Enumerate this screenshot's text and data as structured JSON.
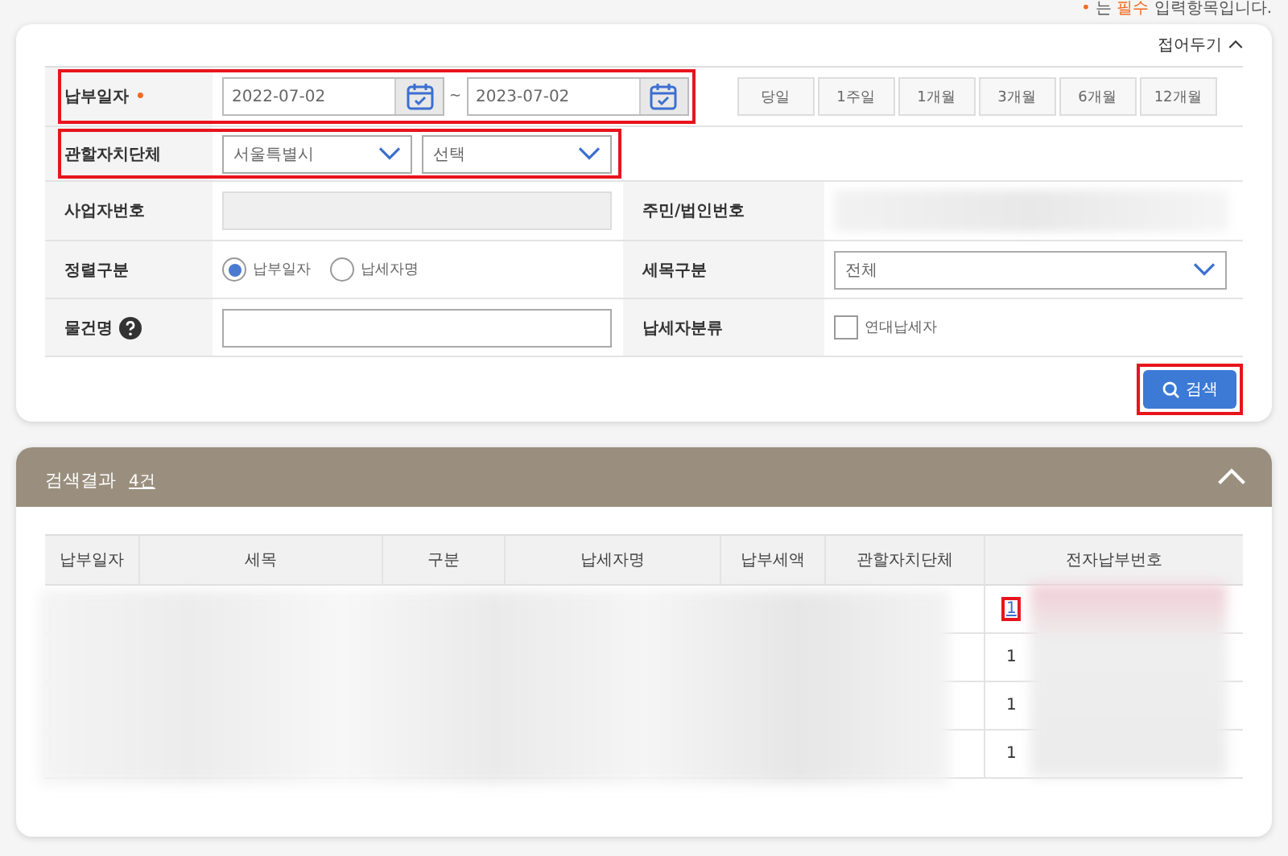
{
  "required_note": {
    "mark": "•",
    "before": "는",
    "highlight": "필수",
    "after": "입력항목입니다."
  },
  "collapse_toggle": {
    "label": "접어두기",
    "expanded": true
  },
  "form": {
    "payment_date": {
      "label": "납부일자",
      "required": true,
      "required_mark": "•",
      "highlighted": true,
      "from": "2022-07-02",
      "separator": "~",
      "to": "2023-07-02"
    },
    "periods": [
      {
        "label": "당일",
        "selected": false
      },
      {
        "label": "1주일",
        "selected": false
      },
      {
        "label": "1개월",
        "selected": false
      },
      {
        "label": "3개월",
        "selected": false
      },
      {
        "label": "6개월",
        "selected": false
      },
      {
        "label": "12개월",
        "selected": false
      }
    ],
    "region": {
      "label": "관할자치단체",
      "highlighted": true,
      "selects": [
        "서울특별시",
        "선택"
      ]
    },
    "business_number": {
      "label": "사업자번호",
      "disabled": true
    },
    "resident_number": {
      "label": "주민/법인번호",
      "redacted": true
    },
    "sort": {
      "label": "정렬구분",
      "options": [
        {
          "label": "납부일자",
          "selected": true
        },
        {
          "label": "납세자명",
          "selected": false
        }
      ]
    },
    "tax_item": {
      "label": "세목구분",
      "value": "전체"
    },
    "property": {
      "label": "물건명",
      "help": true
    },
    "taxpayer_type": {
      "label": "납세자분류",
      "options": [
        {
          "label": "연대납세자",
          "checked": false
        }
      ]
    },
    "search_button": {
      "label": "검색",
      "highlighted": true
    }
  },
  "results": {
    "title": "검색결과",
    "count": "4건",
    "expanded": true,
    "columns": [
      "납부일자",
      "세목",
      "구분",
      "납세자명",
      "납부세액",
      "관할자치단체",
      "전자납부번호"
    ],
    "rows": [
      {
        "number": "1",
        "link": true,
        "highlighted": true
      },
      {
        "number": "1",
        "link": false,
        "highlighted": false
      },
      {
        "number": "1",
        "link": false,
        "highlighted": false
      },
      {
        "number": "1",
        "link": false,
        "highlighted": false
      }
    ],
    "redacted": true
  }
}
